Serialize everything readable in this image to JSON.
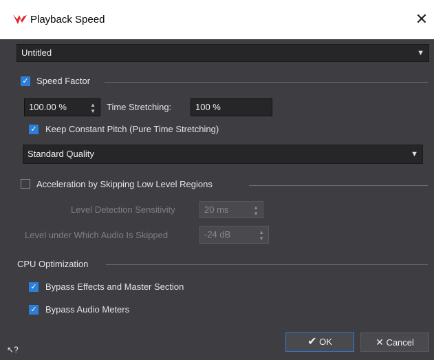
{
  "window": {
    "title": "Playback Speed",
    "close_glyph": "✕"
  },
  "preset": {
    "value": "Untitled"
  },
  "speed_factor": {
    "label": "Speed Factor",
    "checked": true,
    "value": "100.00 %",
    "time_stretching_label": "Time Stretching:",
    "time_stretching_value": "100 %",
    "keep_pitch_label": "Keep Constant Pitch (Pure Time Stretching)",
    "keep_pitch_checked": true,
    "quality": "Standard Quality"
  },
  "acceleration": {
    "label": "Acceleration by Skipping Low Level Regions",
    "checked": false,
    "sensitivity_label": "Level Detection Sensitivity",
    "sensitivity_value": "20 ms",
    "level_label": "Level under Which Audio Is Skipped",
    "level_value": "-24 dB"
  },
  "cpu": {
    "label": "CPU Optimization",
    "bypass_effects_label": "Bypass Effects and Master Section",
    "bypass_effects_checked": true,
    "bypass_meters_label": "Bypass Audio Meters",
    "bypass_meters_checked": true
  },
  "buttons": {
    "ok": "OK",
    "cancel": "Cancel"
  },
  "help_glyph": "↖?",
  "colors": {
    "accent": "#2b7fd8",
    "dialog_bg": "#3e3e42",
    "field_bg": "#262628",
    "logo": "#e0242b"
  }
}
